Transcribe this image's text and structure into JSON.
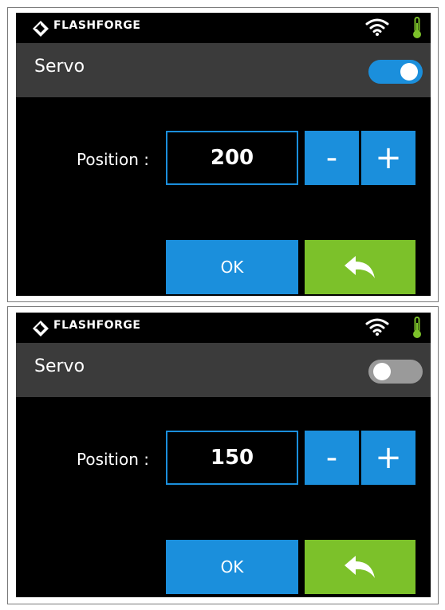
{
  "colors": {
    "accent_blue": "#1b8fdc",
    "back_green": "#7cc12a",
    "title_bar_gray": "#3b3b3b",
    "thermometer_green": "#7cc12a",
    "screen_background": "#000000"
  },
  "panels": [
    {
      "status_bar": {
        "brand": "FLASHFORGE",
        "brand_icon": "flashforge-logo-icon",
        "wifi_icon": "wifi-icon",
        "temperature_icon": "thermometer-icon"
      },
      "title": "Servo",
      "servo_toggle": {
        "state": "on"
      },
      "position_label": "Position :",
      "position_value": "200",
      "minus_label": "-",
      "plus_label": "+",
      "ok_label": "OK",
      "back_icon": "back-arrow-icon"
    },
    {
      "status_bar": {
        "brand": "FLASHFORGE",
        "brand_icon": "flashforge-logo-icon",
        "wifi_icon": "wifi-icon",
        "temperature_icon": "thermometer-icon"
      },
      "title": "Servo",
      "servo_toggle": {
        "state": "off"
      },
      "position_label": "Position :",
      "position_value": "150",
      "minus_label": "-",
      "plus_label": "+",
      "ok_label": "OK",
      "back_icon": "back-arrow-icon"
    }
  ]
}
